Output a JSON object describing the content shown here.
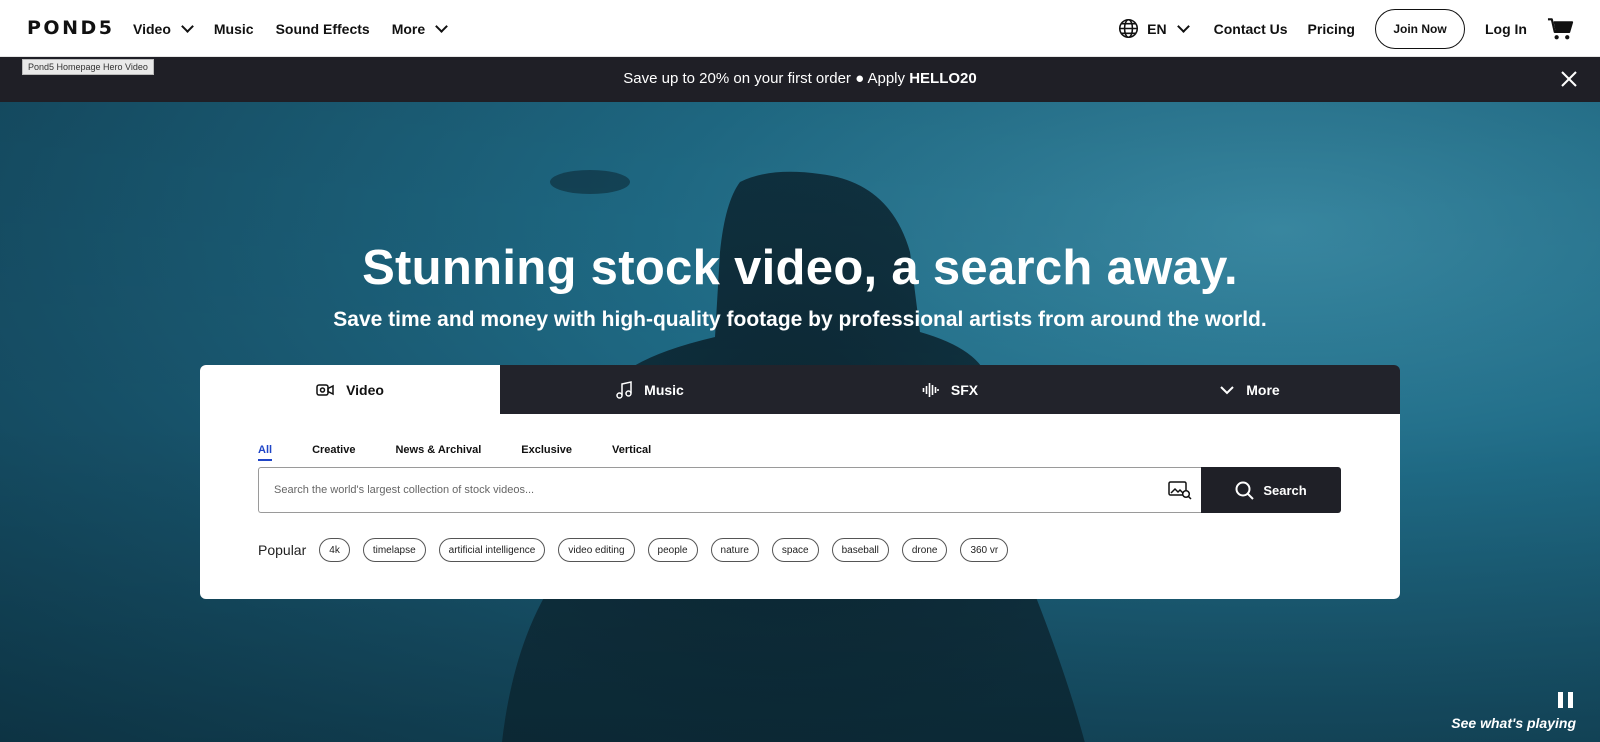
{
  "header": {
    "logo": "POND5",
    "nav": [
      {
        "label": "Video",
        "has_dropdown": true
      },
      {
        "label": "Music",
        "has_dropdown": false
      },
      {
        "label": "Sound Effects",
        "has_dropdown": false
      },
      {
        "label": "More",
        "has_dropdown": true
      }
    ],
    "language": "EN",
    "contact": "Contact Us",
    "pricing": "Pricing",
    "join": "Join Now",
    "login": "Log In"
  },
  "promo": {
    "text": "Save up to 20% on your first order ● Apply ",
    "code": "HELLO20"
  },
  "hero": {
    "tag": "Pond5 Homepage Hero Video",
    "title": "Stunning stock video, a search away.",
    "subtitle": "Save time and money with high-quality footage by professional artists from around the world."
  },
  "search": {
    "tabs": [
      {
        "label": "Video",
        "icon": "video-camera-icon",
        "active": true
      },
      {
        "label": "Music",
        "icon": "music-note-icon",
        "active": false
      },
      {
        "label": "SFX",
        "icon": "waveform-icon",
        "active": false
      },
      {
        "label": "More",
        "icon": "chevron-down-icon",
        "active": false
      }
    ],
    "subtabs": [
      "All",
      "Creative",
      "News & Archival",
      "Exclusive",
      "Vertical"
    ],
    "active_subtab": "All",
    "placeholder": "Search the world's largest collection of stock videos...",
    "button": "Search",
    "popular_label": "Popular",
    "popular": [
      "4k",
      "timelapse",
      "artificial intelligence",
      "video editing",
      "people",
      "nature",
      "space",
      "baseball",
      "drone",
      "360 vr"
    ]
  },
  "player": {
    "see_playing": "See what's playing"
  },
  "colors": {
    "promo_bg": "#1f1f26",
    "tab_bg": "#22232b",
    "active_subtab": "#1f45c7",
    "hero_teal": "#1f6b86"
  }
}
